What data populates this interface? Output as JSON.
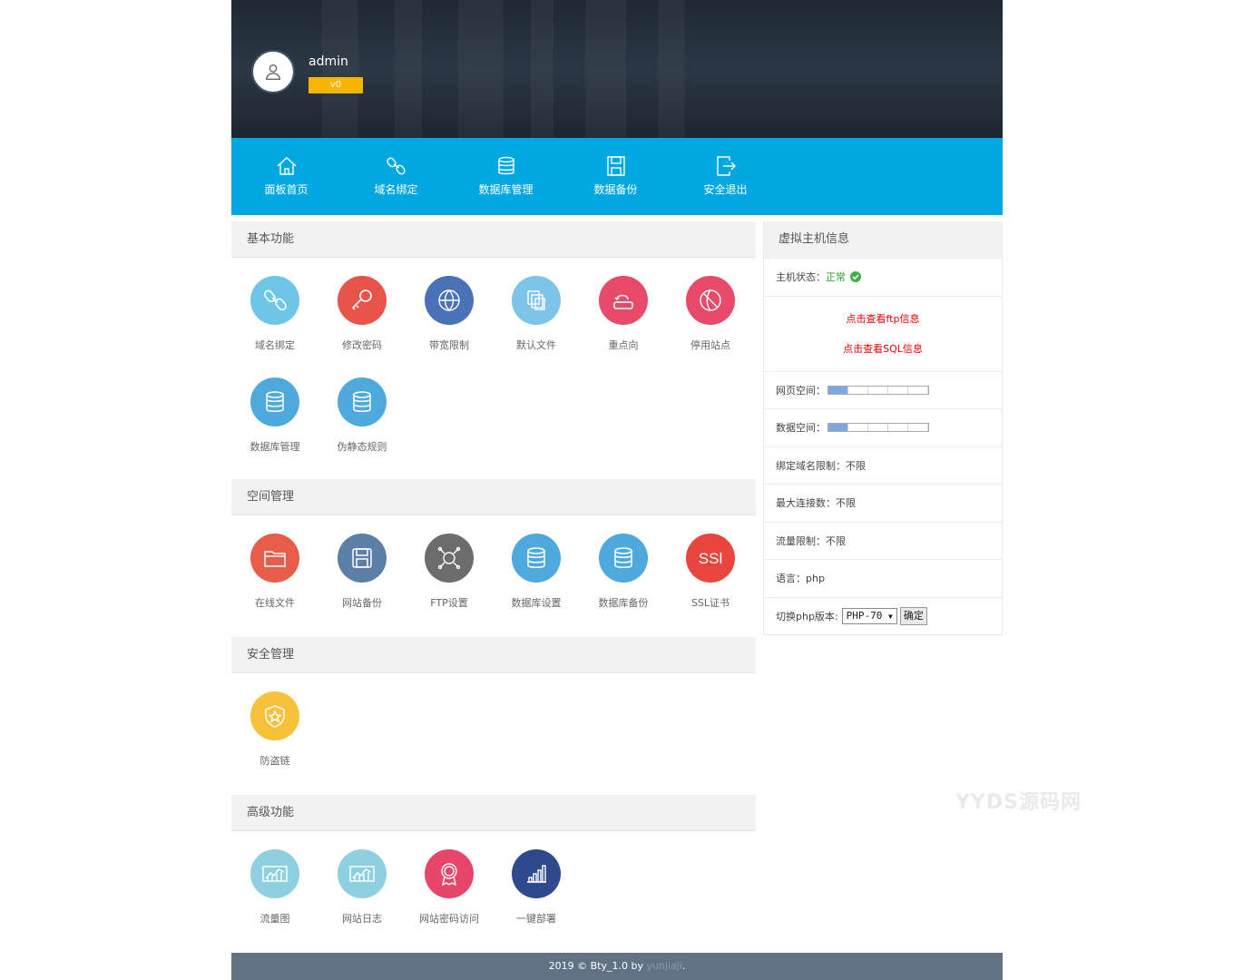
{
  "user": {
    "name": "admin",
    "badge": "v0"
  },
  "nav": [
    {
      "label": "面板首页",
      "icon": "home-icon"
    },
    {
      "label": "域名绑定",
      "icon": "link-icon"
    },
    {
      "label": "数据库管理",
      "icon": "database-icon"
    },
    {
      "label": "数据备份",
      "icon": "save-icon"
    },
    {
      "label": "安全退出",
      "icon": "logout-icon"
    }
  ],
  "sections": [
    {
      "title": "基本功能",
      "tiles": [
        {
          "label": "域名绑定",
          "icon": "link-icon",
          "color": "#6ec6e6"
        },
        {
          "label": "修改密码",
          "icon": "key-icon",
          "color": "#e8534a"
        },
        {
          "label": "带宽限制",
          "icon": "globe-icon",
          "color": "#4a72b8"
        },
        {
          "label": "默认文件",
          "icon": "files-icon",
          "color": "#7cc4e8"
        },
        {
          "label": "重点向",
          "icon": "redirect-icon",
          "color": "#e84a6a"
        },
        {
          "label": "停用站点",
          "icon": "globe-block-icon",
          "color": "#e84a6a"
        },
        {
          "label": "数据库管理",
          "icon": "database-icon",
          "color": "#4ea9dc"
        },
        {
          "label": "伪静态规则",
          "icon": "database-icon",
          "color": "#4ea9dc"
        }
      ]
    },
    {
      "title": "空间管理",
      "tiles": [
        {
          "label": "在线文件",
          "icon": "folder-icon",
          "color": "#e85c4a"
        },
        {
          "label": "网站备份",
          "icon": "floppy-icon",
          "color": "#5b7fa6"
        },
        {
          "label": "FTP设置",
          "icon": "network-icon",
          "color": "#6c6c6c"
        },
        {
          "label": "数据库设置",
          "icon": "database-icon",
          "color": "#4ea9dc"
        },
        {
          "label": "数据库备份",
          "icon": "database-icon",
          "color": "#4ea9dc"
        },
        {
          "label": "SSL证书",
          "icon": "ssl-icon",
          "color": "#e8453c"
        }
      ]
    },
    {
      "title": "安全管理",
      "tiles": [
        {
          "label": "防盗链",
          "icon": "shield-icon",
          "color": "#f7c23a"
        }
      ]
    },
    {
      "title": "高级功能",
      "tiles": [
        {
          "label": "流量图",
          "icon": "chart-icon",
          "color": "#8ed0e0"
        },
        {
          "label": "网站日志",
          "icon": "chart-icon",
          "color": "#8ed0e0"
        },
        {
          "label": "网站密码访问",
          "icon": "badge-icon",
          "color": "#e8456a"
        },
        {
          "label": "一键部署",
          "icon": "bars-icon",
          "color": "#2f4a8c"
        }
      ]
    }
  ],
  "side": {
    "title": "虚拟主机信息",
    "status_label": "主机状态：",
    "status_value": "正常",
    "ftp_link": "点击查看ftp信息",
    "sql_link": "点击查看SQL信息",
    "web_space_label": "网页空间：",
    "web_space_fraction": 0.2,
    "db_space_label": "数据空间：",
    "db_space_fraction": 0.2,
    "domain_limit": "绑定域名限制：不限",
    "max_conn": "最大连接数：不限",
    "traffic_limit": "流量限制：不限",
    "language": "语言：php",
    "php_switch_label": "切换php版本:",
    "php_version": "PHP-70",
    "confirm": "确定"
  },
  "watermark": "YYDS源码网",
  "footer": {
    "text": "2019 © Bty_1.0 by",
    "author": "yunjiaji",
    "end": "."
  }
}
